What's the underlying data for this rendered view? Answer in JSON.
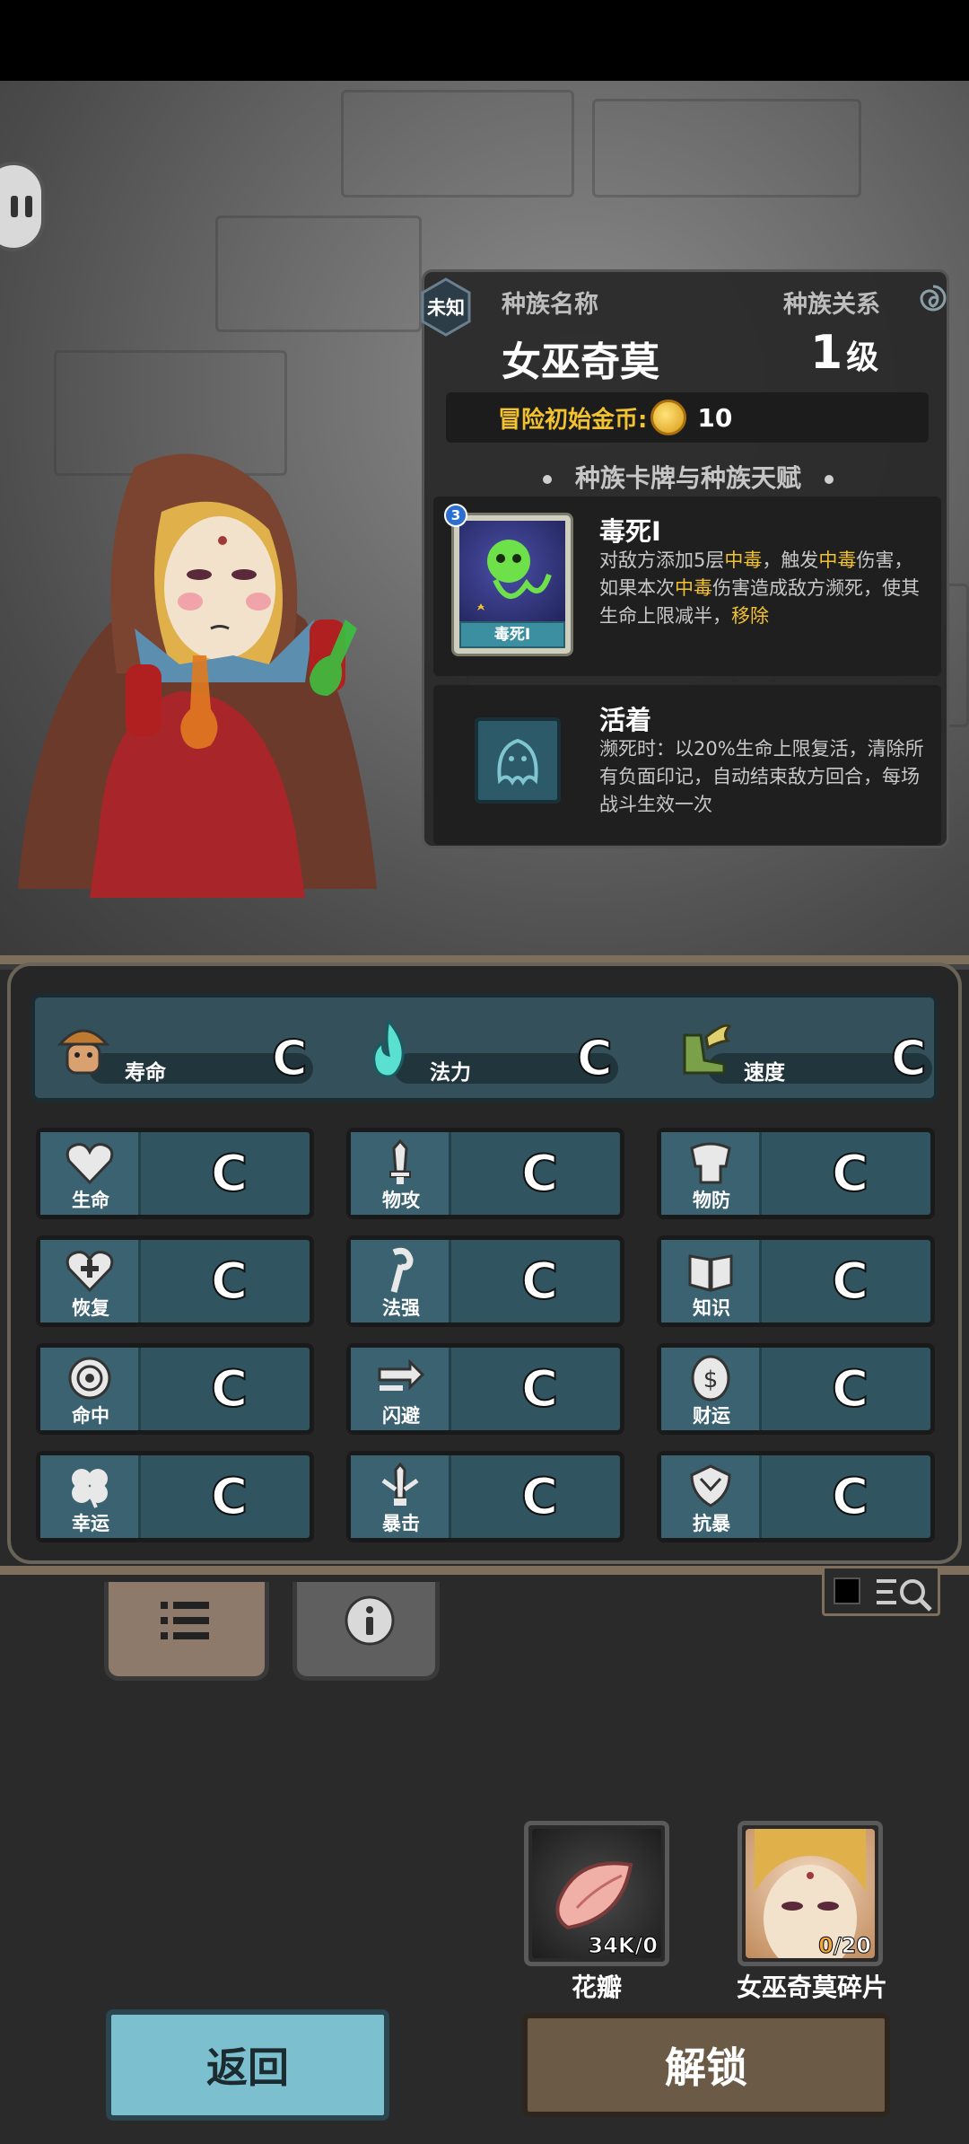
{
  "race_panel": {
    "unknown_badge": "未知",
    "race_name_label": "种族名称",
    "race_relation_label": "种族关系",
    "race_name": "女巫奇莫",
    "level_number": "1",
    "level_unit": "级",
    "gold_label": "冒险初始金币:",
    "gold_value": "10",
    "section_title": "种族卡牌与种族天赋",
    "talents": [
      {
        "name": "毒死Ⅰ",
        "card_caption": "毒死Ⅰ",
        "card_rank": "3",
        "desc_parts": [
          "对敌方添加5层",
          "中毒",
          "，触发",
          "中毒",
          "伤害，如果本次",
          "中毒",
          "伤害造成敌方濒死，使其生命上限减半，",
          "移除"
        ]
      },
      {
        "name": "活着",
        "desc": "濒死时：以20%生命上限复活，清除所有负面印记，自动结束敌方回合，每场战斗生效一次"
      }
    ]
  },
  "top_stats": [
    {
      "label": "寿命",
      "grade": "C",
      "icon": "mushroom-creature-icon"
    },
    {
      "label": "法力",
      "grade": "C",
      "icon": "blue-flame-icon"
    },
    {
      "label": "速度",
      "grade": "C",
      "icon": "winged-boot-icon"
    }
  ],
  "stats": [
    {
      "label": "生命",
      "grade": "C",
      "icon": "heart-icon"
    },
    {
      "label": "物攻",
      "grade": "C",
      "icon": "sword-icon"
    },
    {
      "label": "物防",
      "grade": "C",
      "icon": "armor-icon"
    },
    {
      "label": "恢复",
      "grade": "C",
      "icon": "heart-plus-icon"
    },
    {
      "label": "法强",
      "grade": "C",
      "icon": "staff-icon"
    },
    {
      "label": "知识",
      "grade": "C",
      "icon": "book-icon"
    },
    {
      "label": "命中",
      "grade": "C",
      "icon": "target-icon"
    },
    {
      "label": "闪避",
      "grade": "C",
      "icon": "dodge-arrow-icon"
    },
    {
      "label": "财运",
      "grade": "C",
      "icon": "coin-icon"
    },
    {
      "label": "幸运",
      "grade": "C",
      "icon": "clover-icon"
    },
    {
      "label": "暴击",
      "grade": "C",
      "icon": "crit-sword-icon"
    },
    {
      "label": "抗暴",
      "grade": "C",
      "icon": "shield-burst-icon"
    }
  ],
  "resources": [
    {
      "label": "花瓣",
      "count": "34K/0"
    },
    {
      "label": "女巫奇莫碎片",
      "count_have": "0",
      "count_need": "/20"
    }
  ],
  "buttons": {
    "back": "返回",
    "unlock": "解锁"
  },
  "colors": {
    "highlight": "#f2c230",
    "stat_cell": "#305561",
    "back_button": "#7cc0d0",
    "unlock_button": "#6a5a46"
  }
}
